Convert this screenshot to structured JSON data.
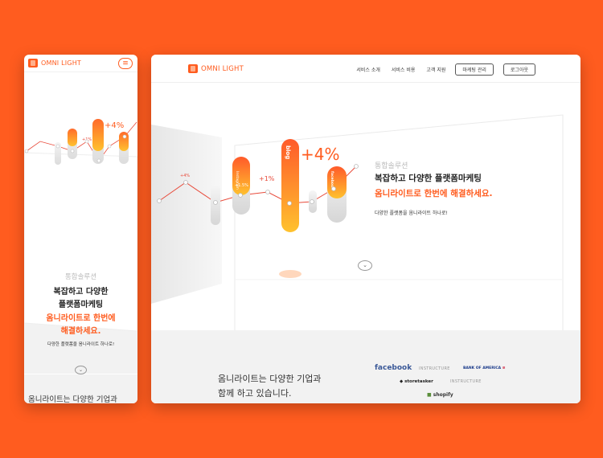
{
  "brand": {
    "name": "OMNI LIGHT",
    "color": "#ff5c1f"
  },
  "mobile": {
    "menu_icon": "hamburger-icon",
    "eyebrow": "통합솔루션",
    "headline_1": "복잡하고 다양한",
    "headline_2": "플랫폼마케팅",
    "accent_1": "옴니라이트로 한번에",
    "accent_2": "해결하세요.",
    "sub": "다양한 플랫폼을 옴니라이트 하나로!",
    "scroll_icon": "chevron-down-icon",
    "bottom_text": "옴니라이트는 다양한 기업과",
    "pill_labels": {
      "p1": "+4%",
      "p2": "+1%",
      "big": "+4%"
    }
  },
  "desktop": {
    "nav": {
      "items": [
        "서비스 소개",
        "서비스 비용",
        "고객 지원"
      ],
      "btn_marketing": "마케팅 관리",
      "btn_logout": "로그아웃"
    },
    "hero": {
      "eyebrow": "통합솔루션",
      "headline": "복잡하고 다양한 플랫폼마케팅",
      "accent": "옴니라이트로 한번에 해결하세요.",
      "sub": "다양한 플랫폼을 옴니라이트 하나로!",
      "scroll_icon": "chevron-down-icon",
      "pill_labels": {
        "small": "+4%",
        "instagram": "Instagram",
        "insta_pct": "+1.5%",
        "plus1": "+1%",
        "blog": "blog",
        "big": "+4%",
        "facebook": "facebook"
      }
    },
    "partners_title_1": "옴니라이트는 다양한 기업과",
    "partners_title_2": "함께 하고 있습니다.",
    "partners": {
      "facebook": "facebook",
      "instructure_1": "INSTRUCTURE",
      "bofa": "BANK OF AMERICA",
      "storetasker": "storetasker",
      "instructure_2": "INSTRUCTURE",
      "shopify": "shopify"
    },
    "colors": {
      "facebook": "#3b5998",
      "bofa": "#c8102e",
      "shopify": "#5a8e3a"
    }
  }
}
